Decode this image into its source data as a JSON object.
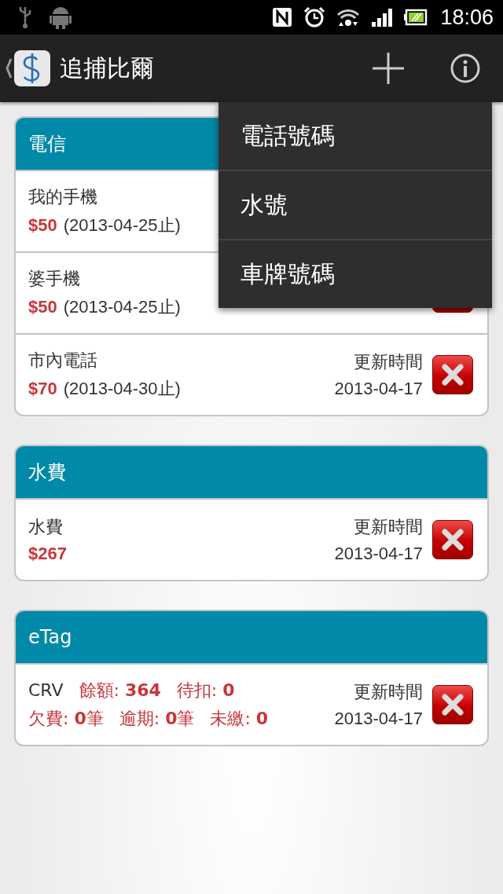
{
  "status_bar": {
    "time": "18:06"
  },
  "action_bar": {
    "title": "追捕比爾"
  },
  "menu": {
    "items": [
      {
        "label": "電話號碼"
      },
      {
        "label": "水號"
      },
      {
        "label": "車牌號碼"
      }
    ]
  },
  "cards": [
    {
      "title": "電信",
      "rows": [
        {
          "kind": "bill",
          "name": "我的手機",
          "amount": "$50",
          "due": "(2013-04-25止)",
          "delete_button": false
        },
        {
          "kind": "bill",
          "name": "婆手機",
          "amount": "$50",
          "due": "(2013-04-25止)",
          "delete_button": true
        },
        {
          "kind": "bill",
          "name": "市內電話",
          "amount": "$70",
          "due": "(2013-04-30止)",
          "updated_label": "更新時間",
          "updated_date": "2013-04-17",
          "delete_button": true
        }
      ]
    },
    {
      "title": "水費",
      "rows": [
        {
          "kind": "bill",
          "name": "水費",
          "amount": "$267",
          "updated_label": "更新時間",
          "updated_date": "2013-04-17",
          "delete_button": true
        }
      ]
    },
    {
      "title": "eTag",
      "rows": [
        {
          "kind": "etag",
          "name": "CRV",
          "line1": [
            "餘額: **364**",
            "待扣: **0**"
          ],
          "line2": [
            "欠費: **0**筆",
            "逾期: **0**筆",
            "未繳: **0**"
          ],
          "updated_label": "更新時間",
          "updated_date": "2013-04-17",
          "delete_button": true
        }
      ]
    }
  ]
}
